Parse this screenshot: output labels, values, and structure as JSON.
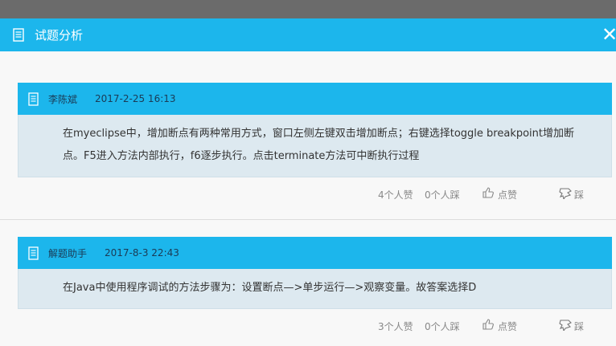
{
  "dialog": {
    "title": "试题分析",
    "close_label": "✕"
  },
  "answers": [
    {
      "author": "李陈斌",
      "date": "2017-2-25 16:13",
      "content": "在myeclipse中，增加断点有两种常用方式，窗口左侧左键双击增加断点；右键选择toggle breakpoint增加断点。F5进入方法内部执行，f6逐步执行。点击terminate方法可中断执行过程",
      "likes_text": "4个人赞",
      "dislikes_text": "0个人踩",
      "like_label": "点赞",
      "dislike_label": "踩"
    },
    {
      "author": "解题助手",
      "date": "2017-8-3 22:43",
      "content": "在Java中使用程序调试的方法步骤为：设置断点—>单步运行—>观察变量。故答案选择D",
      "likes_text": "3个人赞",
      "dislikes_text": "0个人踩",
      "like_label": "点赞",
      "dislike_label": "踩"
    }
  ],
  "icons": {
    "title": "document-icon",
    "answer": "document-icon",
    "like": "thumbs-up-icon",
    "dislike": "thumbs-down-icon"
  },
  "colors": {
    "accent": "#1cb6ec",
    "answer_body": "#dde9f0",
    "overlay": "#6b6b6b"
  }
}
